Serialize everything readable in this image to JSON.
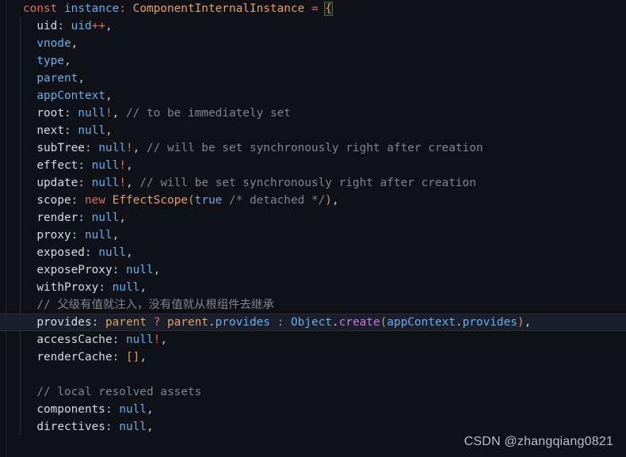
{
  "editor": {
    "background_color": "#0f1117",
    "highlight_line_color": "#1a1f2b",
    "language": "TypeScript",
    "highlighted_line_index": 18
  },
  "palette": {
    "keyword": "#e06c5f",
    "identifier": "#61afef",
    "type": "#e5a15c",
    "property": "#d7dae0",
    "value": "#61afef",
    "punctuation": "#bfc6d0",
    "operator": "#e06c5f",
    "bracket": "#d19a66",
    "comment": "#7f848e",
    "function": "#c678dd",
    "match_bracket_outline": "#2f7d32"
  },
  "code": {
    "lines": [
      "const instance: ComponentInternalInstance = {",
      "  uid: uid++,",
      "  vnode,",
      "  type,",
      "  parent,",
      "  appContext,",
      "  root: null!, // to be immediately set",
      "  next: null,",
      "  subTree: null!, // will be set synchronously right after creation",
      "  effect: null!,",
      "  update: null!, // will be set synchronously right after creation",
      "  scope: new EffectScope(true /* detached */),",
      "  render: null,",
      "  proxy: null,",
      "  exposed: null,",
      "  exposeProxy: null,",
      "  withProxy: null,",
      "  // 父级有值就注入，没有值就从根组件去继承",
      "  provides: parent ? parent.provides : Object.create(appContext.provides),",
      "  accessCache: null!,",
      "  renderCache: [],",
      "",
      "  // local resolved assets",
      "  components: null,",
      "  directives: null,"
    ],
    "tokens": {
      "line_0": [
        "const",
        " ",
        "instance",
        ":",
        " ",
        "ComponentInternalInstance",
        " = ",
        "{"
      ],
      "line_1": [
        "uid",
        ":",
        " ",
        "uid",
        "++",
        ","
      ],
      "line_6_comment": "// to be immediately set",
      "line_8_comment": "// will be set synchronously right after creation",
      "line_10_comment": "// will be set synchronously right after creation",
      "line_11_inline_comment": "/* detached */",
      "line_17_comment": "// 父级有值就注入，没有值就从根组件去继承",
      "line_22_comment": "// local resolved assets"
    }
  },
  "watermark": {
    "text": "CSDN @zhangqiang0821"
  }
}
